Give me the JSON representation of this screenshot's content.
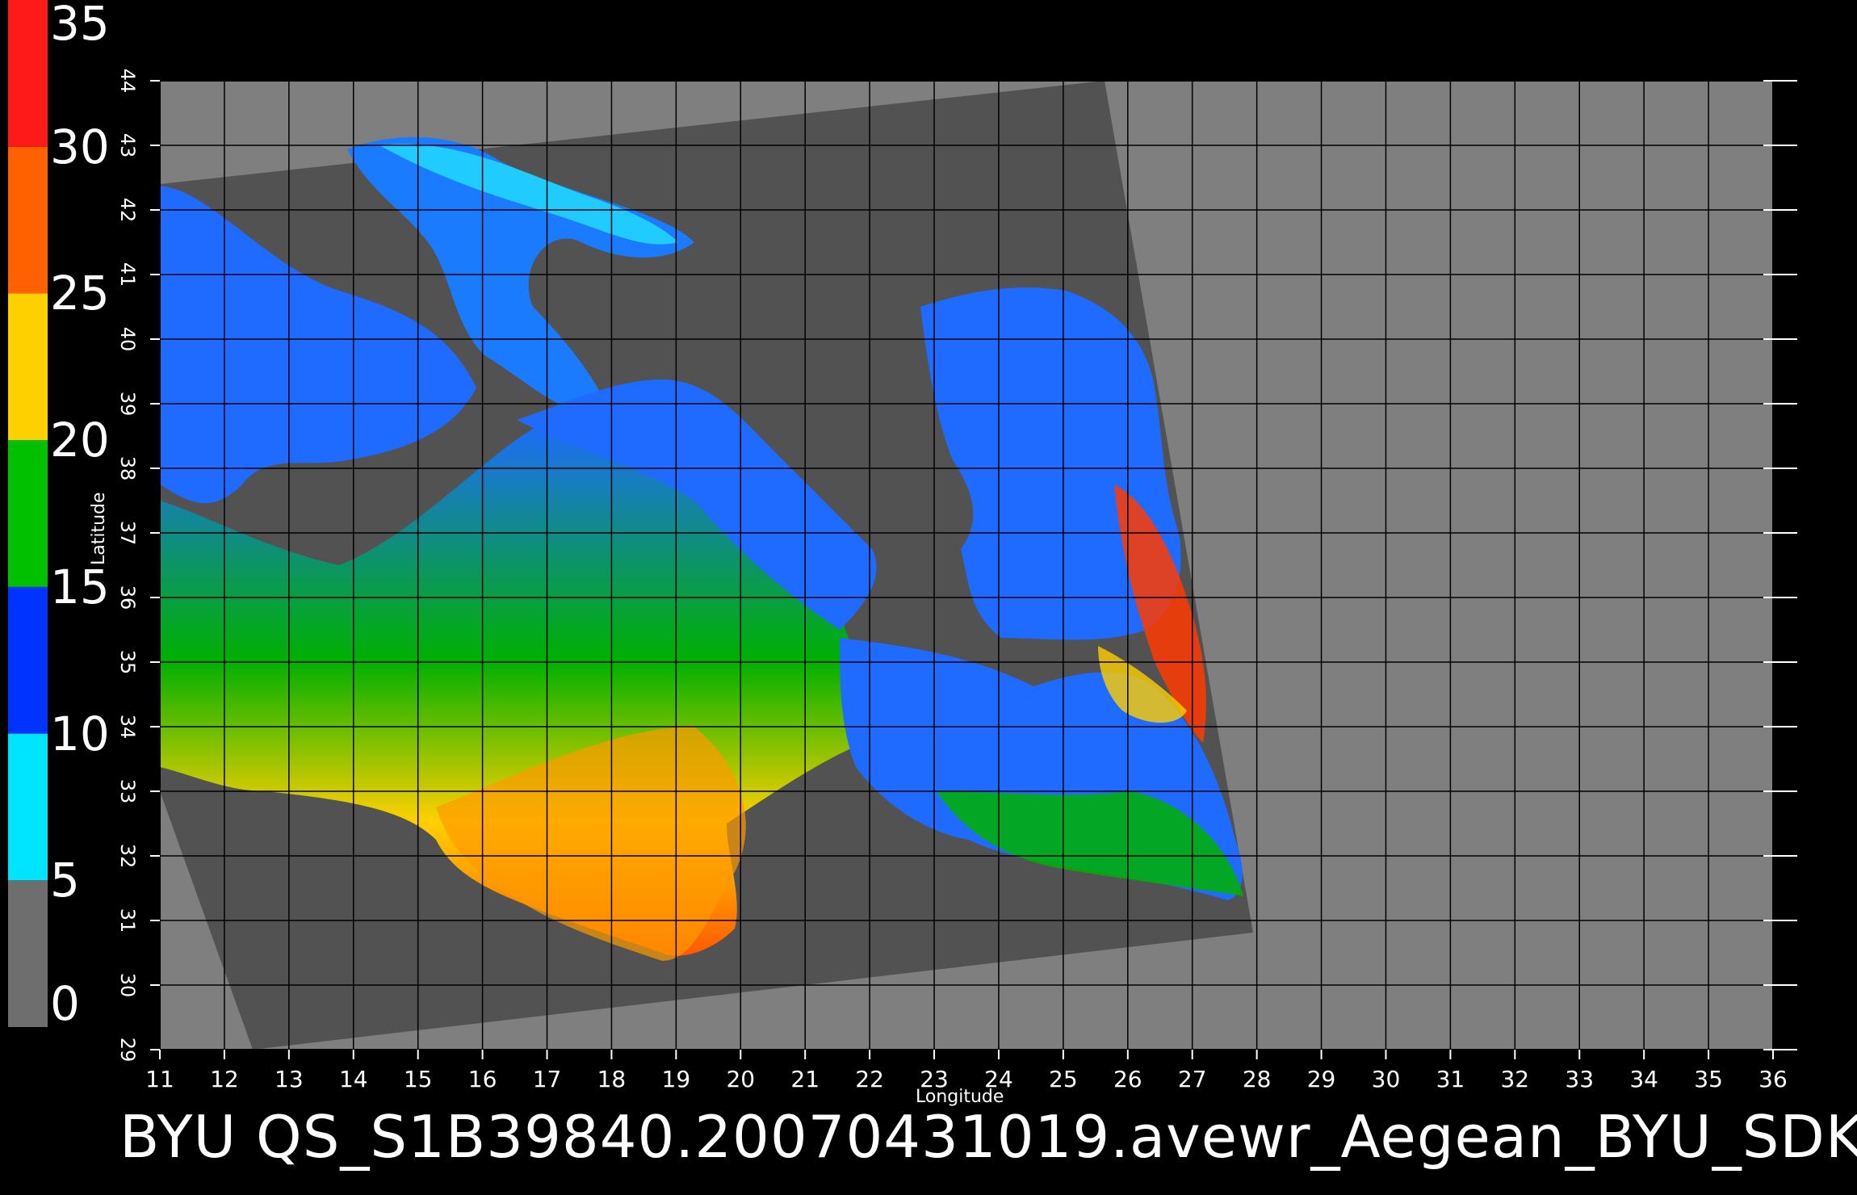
{
  "colorbar": {
    "labels": [
      "35",
      "30",
      "25",
      "20",
      "15",
      "10",
      "5",
      "0"
    ],
    "stops": [
      {
        "from": 0,
        "to": 5,
        "color": "#6e6e6e"
      },
      {
        "from": 5,
        "to": 10,
        "color": "#00e5ff"
      },
      {
        "from": 10,
        "to": 15,
        "color": "#0033ff"
      },
      {
        "from": 15,
        "to": 20,
        "color": "#00c000"
      },
      {
        "from": 20,
        "to": 25,
        "color": "#ffd000"
      },
      {
        "from": 25,
        "to": 30,
        "color": "#ff6000"
      },
      {
        "from": 30,
        "to": 35,
        "color": "#ff1a1a"
      }
    ]
  },
  "axes": {
    "xlabel": "Longitude",
    "ylabel": "Latitude",
    "x_ticks": [
      "11",
      "12",
      "13",
      "14",
      "15",
      "16",
      "17",
      "18",
      "19",
      "20",
      "21",
      "22",
      "23",
      "24",
      "25",
      "26",
      "27",
      "28",
      "29",
      "30",
      "31",
      "32",
      "33",
      "34",
      "35",
      "36"
    ],
    "y_ticks": [
      "29",
      "30",
      "31",
      "32",
      "33",
      "34",
      "35",
      "36",
      "37",
      "38",
      "39",
      "40",
      "41",
      "42",
      "43",
      "44"
    ],
    "xlim": [
      11,
      36
    ],
    "ylim": [
      29,
      44
    ]
  },
  "title": "BYU  QS_S1B39840.20070431019.avewr_Aegean_BYU_SDK",
  "colors": {
    "background": "#000000",
    "land": "#7f7f7f",
    "swath_land": "#525252",
    "grid": "#000000"
  }
}
